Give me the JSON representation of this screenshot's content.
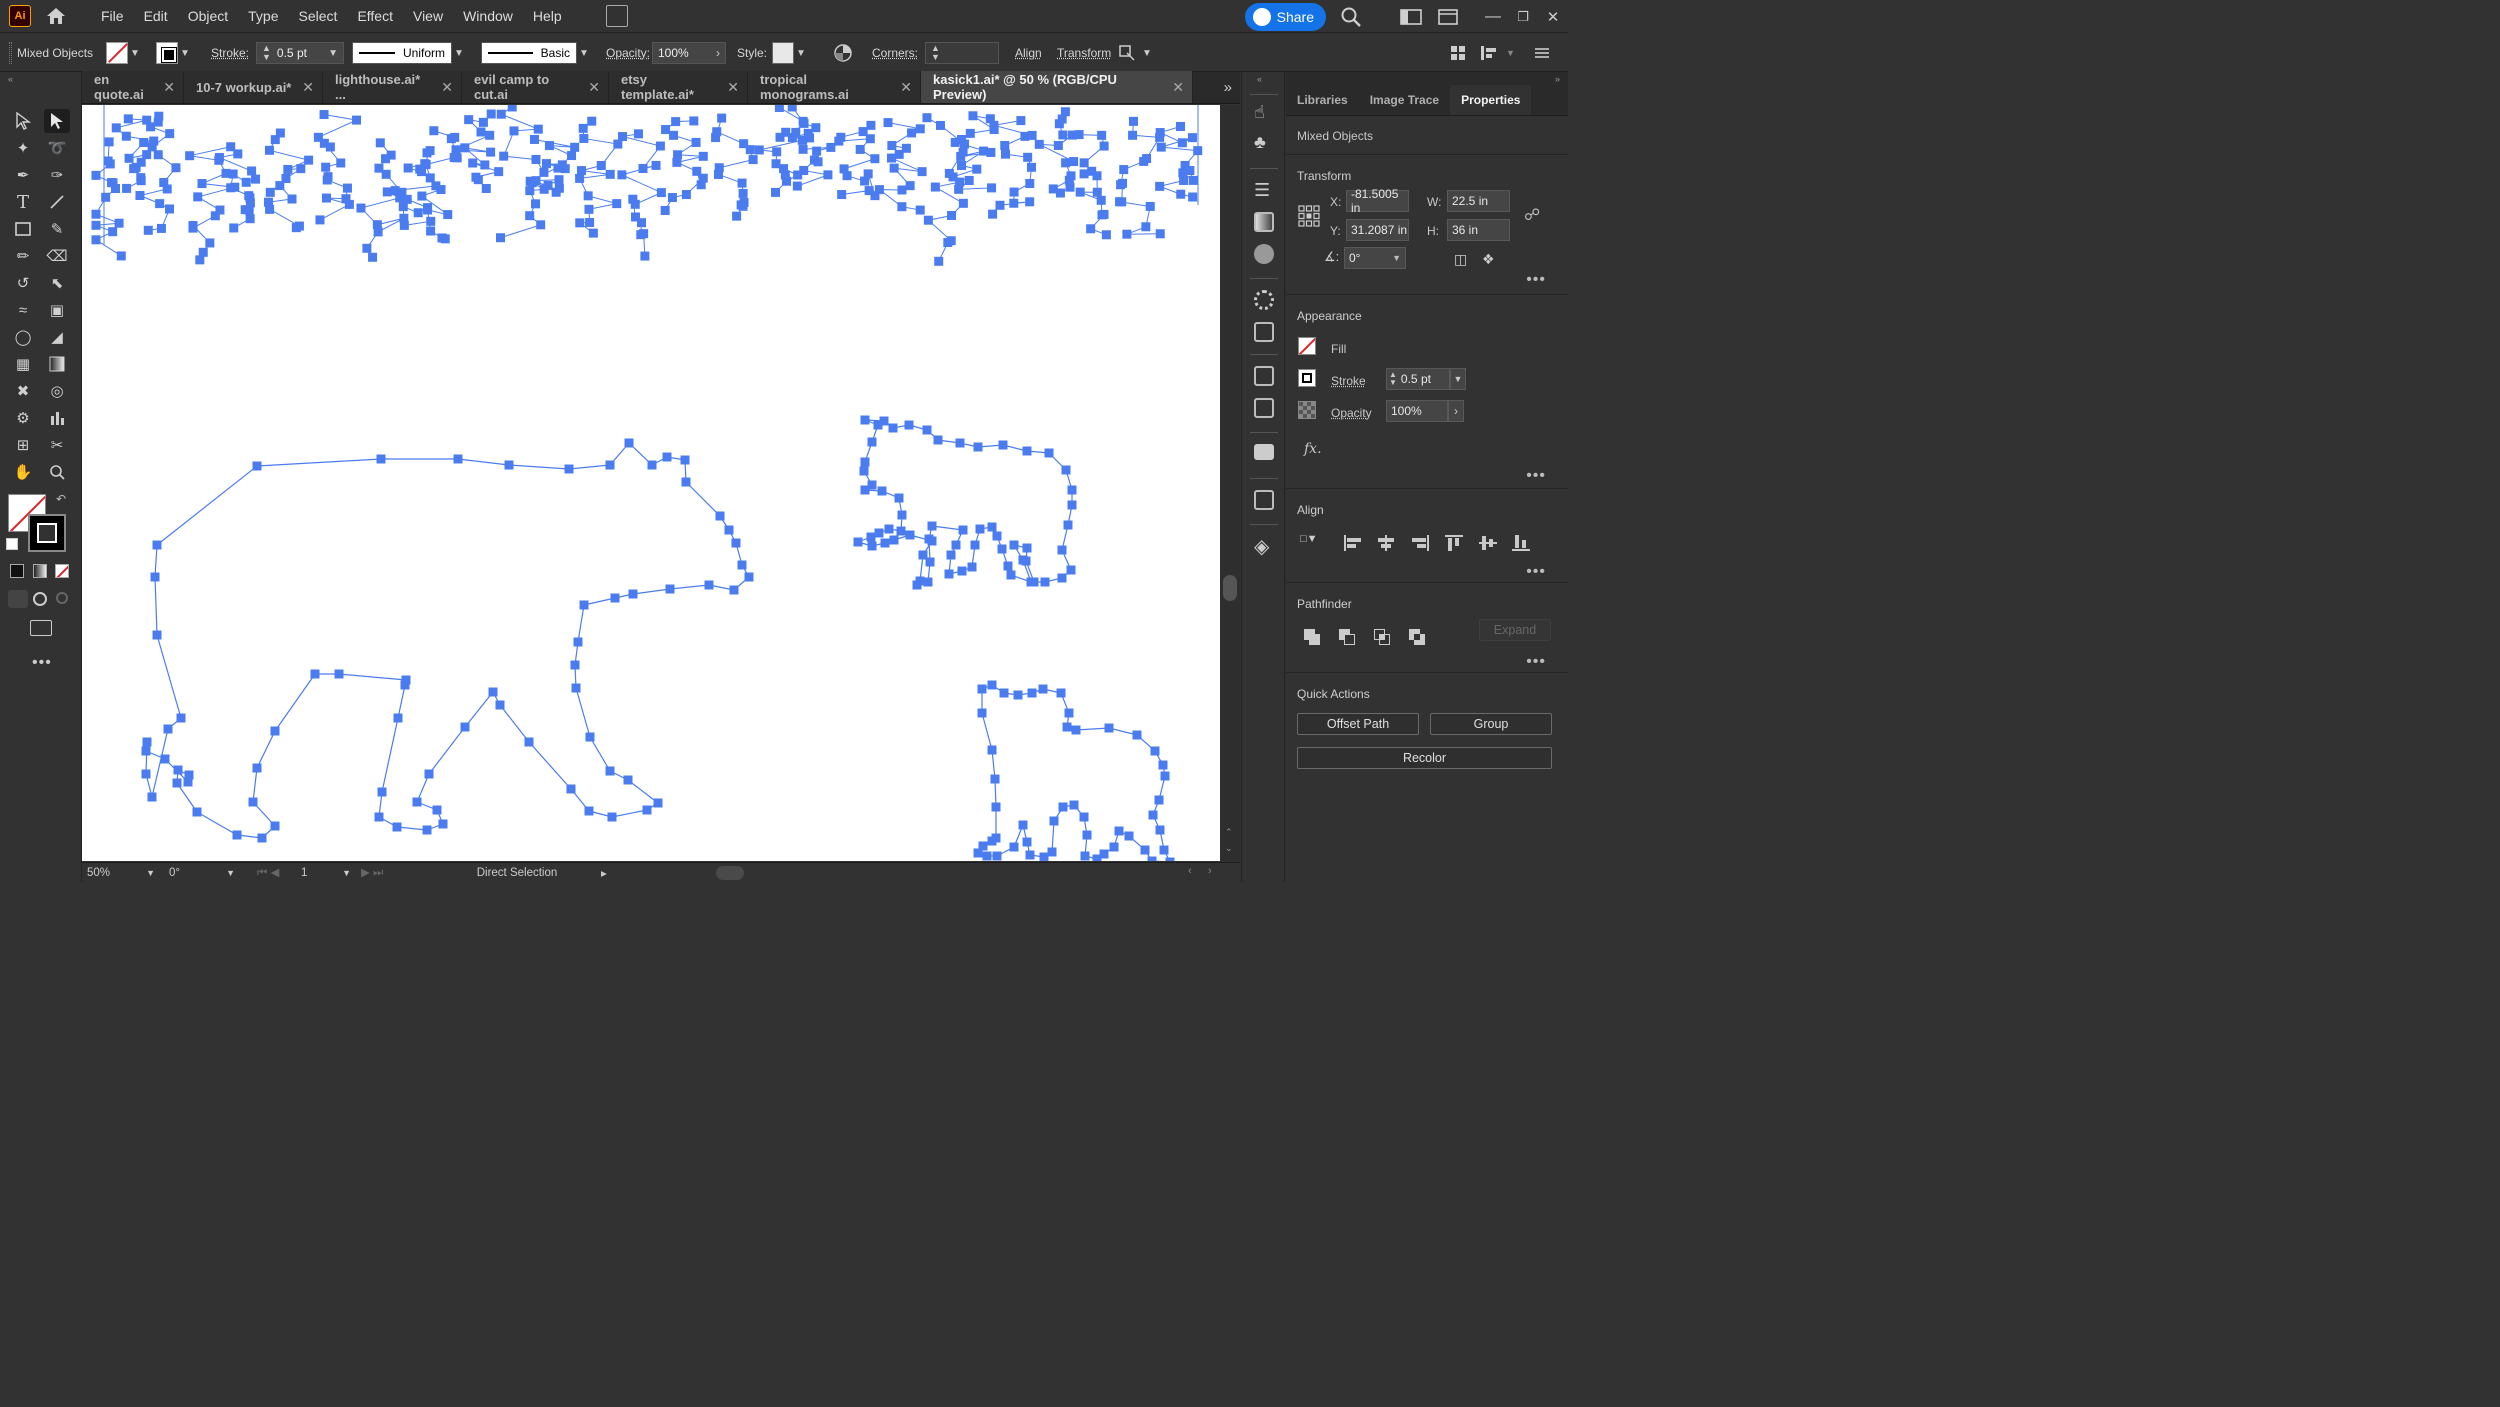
{
  "app": {
    "logo": "Ai",
    "menu": [
      "File",
      "Edit",
      "Object",
      "Type",
      "Select",
      "Effect",
      "View",
      "Window",
      "Help"
    ],
    "share_label": "Share"
  },
  "control": {
    "selection_type": "Mixed Objects",
    "stroke_label": "Stroke:",
    "stroke_value": "0.5 pt",
    "profile_label": "Uniform",
    "brush_label": "Basic",
    "opacity_label": "Opacity:",
    "opacity_value": "100%",
    "style_label": "Style:",
    "corners_label": "Corners:",
    "align_label": "Align",
    "transform_label": "Transform"
  },
  "tabs": [
    {
      "label": "en quote.ai",
      "active": false
    },
    {
      "label": "10-7 workup.ai*",
      "active": false
    },
    {
      "label": "lighthouse.ai* ...",
      "active": false
    },
    {
      "label": "evil camp to cut.ai",
      "active": false
    },
    {
      "label": "etsy template.ai*",
      "active": false
    },
    {
      "label": "tropical monograms.ai",
      "active": false
    },
    {
      "label": "kasick1.ai* @ 50 % (RGB/CPU Preview)",
      "active": true
    }
  ],
  "status": {
    "zoom": "50%",
    "rotation": "0°",
    "artboard": "1",
    "tool": "Direct Selection"
  },
  "properties": {
    "tabs": [
      "Libraries",
      "Image Trace",
      "Properties"
    ],
    "active_tab": "Properties",
    "selection": "Mixed Objects",
    "transform": {
      "title": "Transform",
      "x_label": "X:",
      "x": "-81.5005 in",
      "y_label": "Y:",
      "y": "31.2087 in",
      "w_label": "W:",
      "w": "22.5 in",
      "h_label": "H:",
      "h": "36 in",
      "angle": "0°"
    },
    "appearance": {
      "title": "Appearance",
      "fill_label": "Fill",
      "stroke_label": "Stroke",
      "stroke_value": "0.5 pt",
      "opacity_label": "Opacity",
      "opacity_value": "100%",
      "fx_label": "fx."
    },
    "align": {
      "title": "Align"
    },
    "pathfinder": {
      "title": "Pathfinder",
      "expand_label": "Expand"
    },
    "quick_actions": {
      "title": "Quick Actions",
      "offset_path": "Offset Path",
      "group": "Group",
      "recolor": "Recolor"
    }
  },
  "colors": {
    "accent": "#1473e6",
    "anchor": "#4a7cf0",
    "no_fill": "#e0242a"
  }
}
